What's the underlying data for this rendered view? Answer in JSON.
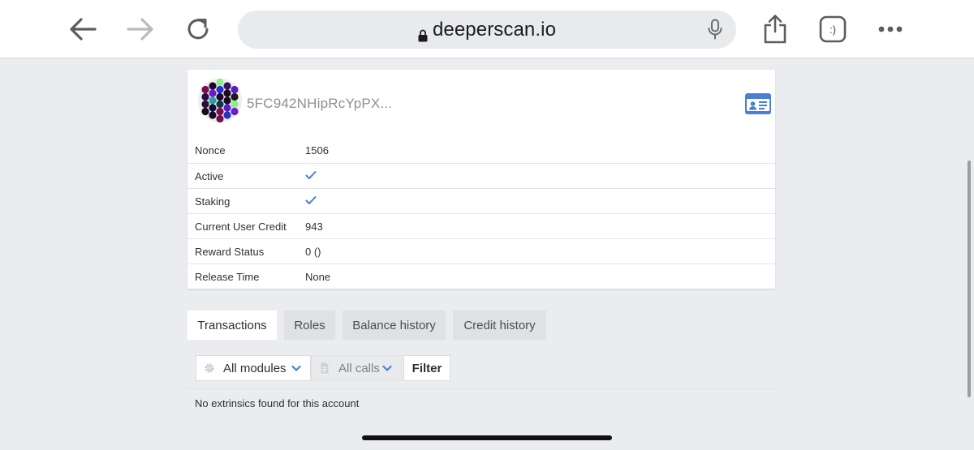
{
  "browser": {
    "url": "deeperscan.io",
    "tabs_button_label": ":)"
  },
  "account": {
    "address_short": "5FC942NHipRcYpPX...",
    "rows": [
      {
        "label": "Nonce",
        "value": "1506",
        "type": "text"
      },
      {
        "label": "Active",
        "value": "",
        "type": "check"
      },
      {
        "label": "Staking",
        "value": "",
        "type": "check"
      },
      {
        "label": "Current User Credit",
        "value": "943",
        "type": "text"
      },
      {
        "label": "Reward Status",
        "value": "0 ()",
        "type": "text"
      },
      {
        "label": "Release Time",
        "value": "None",
        "type": "text"
      }
    ]
  },
  "tabs": [
    {
      "label": "Transactions",
      "active": true
    },
    {
      "label": "Roles",
      "active": false
    },
    {
      "label": "Balance history",
      "active": false
    },
    {
      "label": "Credit history",
      "active": false
    }
  ],
  "filters": {
    "modules_selected": "All modules",
    "calls_selected": "All calls",
    "filter_label": "Filter"
  },
  "empty_message": "No extrinsics found for this account",
  "colors": {
    "accent": "#4a7fd4",
    "page_bg": "#eaecef",
    "tab_inactive": "#dfe1e4"
  },
  "icons": {
    "back": "arrow-left-icon",
    "forward": "arrow-right-icon",
    "reload": "reload-icon",
    "lock": "lock-icon",
    "mic": "microphone-icon",
    "share": "share-icon",
    "tabs": "tabs-icon",
    "more": "more-icon",
    "identity": "id-card-icon",
    "check": "checkmark-icon",
    "modules": "gear-icon",
    "calls": "document-icon",
    "dropdown": "chevron-down-icon"
  }
}
